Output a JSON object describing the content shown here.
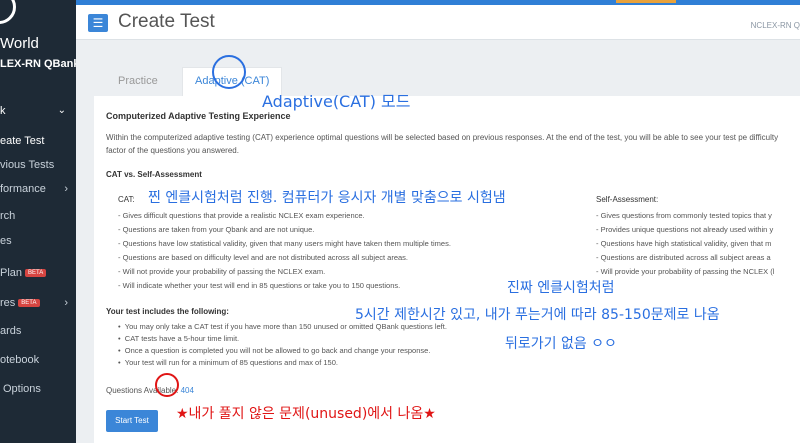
{
  "sidebar": {
    "brand_line1": "World",
    "brand_line2": "LEX-RN QBank",
    "section_label": "k",
    "items": [
      {
        "label": "eate Test",
        "active": true
      },
      {
        "label": "vious Tests"
      },
      {
        "label": "formance"
      },
      {
        "label": "rch"
      },
      {
        "label": "es"
      },
      {
        "label": "Plan",
        "badge": "BETA"
      },
      {
        "label": "res",
        "badge": "BETA"
      },
      {
        "label": "ards"
      },
      {
        "label": "otebook"
      },
      {
        "label": "Options"
      }
    ]
  },
  "header": {
    "menu_icon": "☰",
    "title": "Create Test",
    "right_text": "NCLEX-RN Q"
  },
  "tabs": {
    "practice": "Practice",
    "adaptive": "Adaptive (CAT)"
  },
  "content": {
    "title": "Computerized Adaptive Testing Experience",
    "intro": "Within the computerized adaptive testing (CAT) experience optimal questions will be selected based on previous responses. At the end of the test, you will be able to see your test pe difficulty factor of the questions you answered.",
    "vs_title": "CAT vs. Self-Assessment",
    "cat_label": "CAT:",
    "cat_bullets": [
      "- Gives difficult questions that provide a realistic NCLEX exam experience.",
      "- Questions are taken from your Qbank and are not unique.",
      "- Questions have low statistical validity, given that many users might have taken them multiple times.",
      "- Questions are based on difficulty level and are not distributed across all subject areas.",
      "- Will not provide your probability of passing the NCLEX exam.",
      "- Will indicate whether your test will end in 85 questions or take you to 150 questions."
    ],
    "sa_label": "Self-Assessment:",
    "sa_bullets": [
      "- Gives questions from commonly tested topics that y",
      "- Provides unique questions not already used within y",
      "- Questions have high statistical validity, given that m",
      "- Questions are distributed across all subject areas a",
      "- Will provide your probability of passing the NCLEX (l"
    ],
    "includes_title": "Your test includes the following:",
    "includes": [
      "You may only take a CAT test if you have more than 150 unused or omitted QBank questions left.",
      "CAT tests have a 5-hour time limit.",
      "Once a question is completed you will not be allowed to go back and change your response.",
      "Your test will run for a minimum of 85 questions and max of 150."
    ],
    "questions_available_label": "Questions Available:",
    "questions_available_count": "404",
    "start_button": "Start Test"
  },
  "annotations": {
    "adaptive_mode": "Adaptive(CAT) 모드",
    "cat_note": "찐 엔클시험처럼 진행. 컴퓨터가 응시자 개별 맞춤으로 시험냄",
    "real_nclex": "진짜 엔클시험처럼",
    "time_limit": "5시간 제한시간 있고, 내가 푸는거에 따라 85-150문제로 나옴",
    "no_back": "뒤로가기 없음 ㅇㅇ",
    "unused_note": "★내가 풀지 않은 문제(unused)에서 나옴★"
  }
}
